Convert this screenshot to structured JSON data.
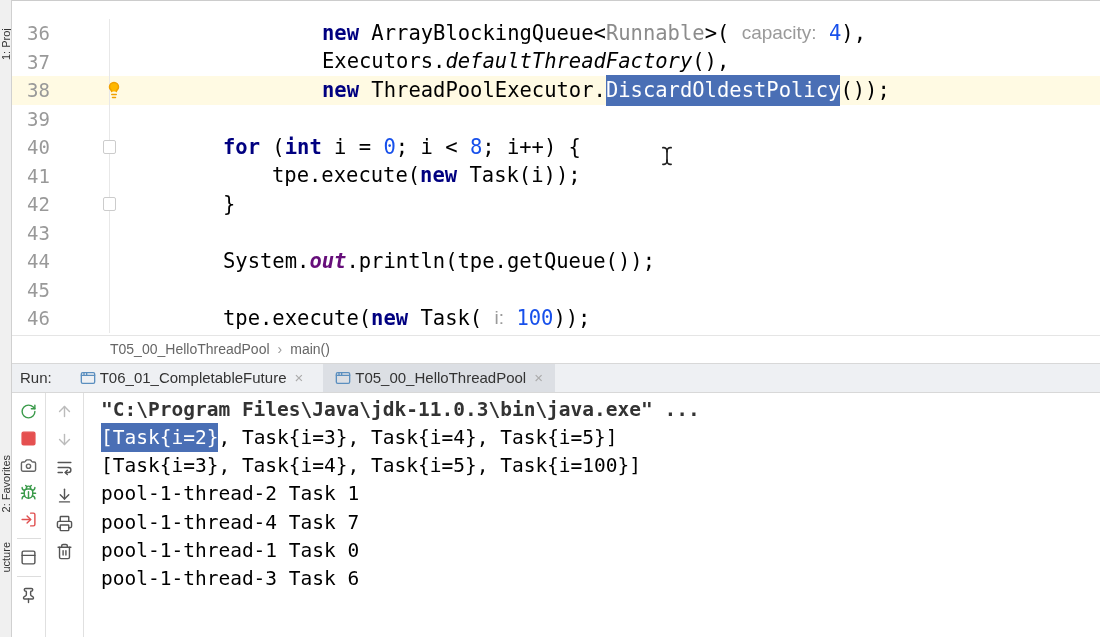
{
  "side_strip": [
    "1: Proj",
    "2: Favorites",
    "ucture"
  ],
  "editor": {
    "lines": [
      {
        "number": "36",
        "kind": "argument",
        "tokens": [
          {
            "kind": "kw",
            "text": "new"
          },
          {
            "kind": "plain",
            "text": " ArrayBlockingQueue<"
          },
          {
            "kind": "generic",
            "text": "Runnable"
          },
          {
            "kind": "plain",
            "text": ">( "
          },
          {
            "kind": "hint",
            "text": "capacity:"
          },
          {
            "kind": "num",
            "text": " 4"
          },
          {
            "kind": "plain",
            "text": "),"
          }
        ]
      },
      {
        "number": "37",
        "kind": "argument",
        "tokens": [
          {
            "kind": "plain",
            "text": "Executors."
          },
          {
            "kind": "italic",
            "text": "defaultThreadFactory"
          },
          {
            "kind": "plain",
            "text": "(),"
          }
        ]
      },
      {
        "number": "38",
        "kind": "argument",
        "current": true,
        "bulb": true,
        "tokens": [
          {
            "kind": "kw",
            "text": "new"
          },
          {
            "kind": "plain",
            "text": " ThreadPoolExecutor."
          },
          {
            "kind": "selection",
            "text": "DiscardOldestPolicy"
          },
          {
            "kind": "plain",
            "text": "());"
          }
        ]
      },
      {
        "number": "39",
        "kind": "blank"
      },
      {
        "number": "40",
        "kind": "statement",
        "fold": true,
        "tokens": [
          {
            "kind": "kw",
            "text": "for"
          },
          {
            "kind": "plain",
            "text": " ("
          },
          {
            "kind": "kw",
            "text": "int"
          },
          {
            "kind": "plain",
            "text": " i = "
          },
          {
            "kind": "num",
            "text": "0"
          },
          {
            "kind": "plain",
            "text": "; i < "
          },
          {
            "kind": "num",
            "text": "8"
          },
          {
            "kind": "plain",
            "text": "; i++) {"
          }
        ]
      },
      {
        "number": "41",
        "kind": "block",
        "tokens": [
          {
            "kind": "plain",
            "text": "tpe.execute("
          },
          {
            "kind": "kw",
            "text": "new"
          },
          {
            "kind": "plain",
            "text": " Task(i));"
          }
        ]
      },
      {
        "number": "42",
        "kind": "statement",
        "fold": true,
        "tokens": [
          {
            "kind": "plain",
            "text": "}"
          }
        ]
      },
      {
        "number": "43",
        "kind": "blank"
      },
      {
        "number": "44",
        "kind": "statement",
        "tokens": [
          {
            "kind": "plain",
            "text": "System."
          },
          {
            "kind": "static",
            "text": "out"
          },
          {
            "kind": "plain",
            "text": ".println(tpe.getQueue());"
          }
        ]
      },
      {
        "number": "45",
        "kind": "blank"
      },
      {
        "number": "46",
        "kind": "statement",
        "tokens": [
          {
            "kind": "plain",
            "text": "tpe.execute("
          },
          {
            "kind": "kw",
            "text": "new"
          },
          {
            "kind": "plain",
            "text": " Task( "
          },
          {
            "kind": "hint",
            "text": "i:"
          },
          {
            "kind": "num",
            "text": " 100"
          },
          {
            "kind": "plain",
            "text": "));"
          }
        ]
      }
    ]
  },
  "breadcrumb": {
    "items": [
      "T05_00_HelloThreadPool",
      "main()"
    ],
    "separator": "›"
  },
  "run_panel": {
    "label": "Run:",
    "tabs": [
      {
        "title": "T06_01_CompletableFuture",
        "close": "×",
        "selected": false
      },
      {
        "title": "T05_00_HelloThreadPool",
        "close": "×",
        "selected": true
      }
    ],
    "console": [
      [
        {
          "kind": "command",
          "text": "\"C:\\Program Files\\Java\\jdk-11.0.3\\bin\\java.exe\" ..."
        }
      ],
      [
        {
          "kind": "selection",
          "text": "[Task{i=2}"
        },
        {
          "kind": "plain",
          "text": ", Task{i=3}, Task{i=4}, Task{i=5}]"
        }
      ],
      [
        {
          "kind": "plain",
          "text": "[Task{i=3}, Task{i=4}, Task{i=5}, Task{i=100}]"
        }
      ],
      [
        {
          "kind": "plain",
          "text": "pool-1-thread-2 Task 1"
        }
      ],
      [
        {
          "kind": "plain",
          "text": "pool-1-thread-4 Task 7"
        }
      ],
      [
        {
          "kind": "plain",
          "text": "pool-1-thread-1 Task 0"
        }
      ],
      [
        {
          "kind": "plain",
          "text": "pool-1-thread-3 Task 6"
        }
      ]
    ]
  }
}
